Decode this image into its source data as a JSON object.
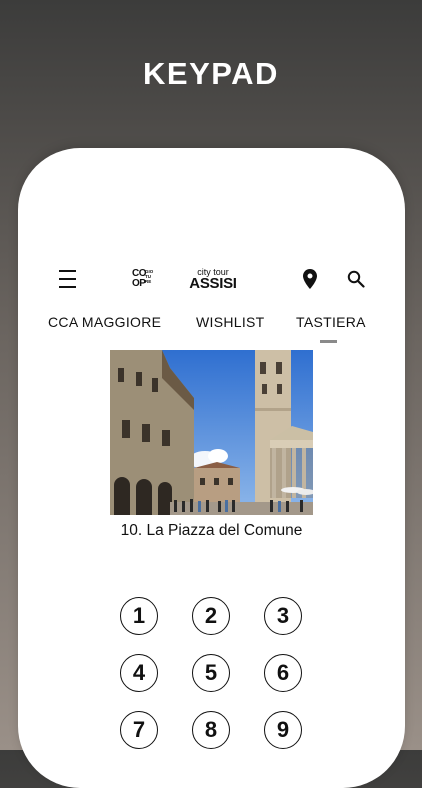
{
  "promo": {
    "title": "KEYPAD"
  },
  "header": {
    "logo_text_1": "CO",
    "logo_text_2": "OP",
    "logo_small_1": "GIO",
    "logo_small_2": "TU",
    "logo_small_3": "RE",
    "subtitle": "city tour",
    "title": "ASSISI"
  },
  "tabs": [
    {
      "label": "CCA MAGGIORE"
    },
    {
      "label": "WISHLIST"
    },
    {
      "label": "TASTIERA",
      "selected": true
    }
  ],
  "content": {
    "caption": "10. La Piazza del Comune"
  },
  "keypad": {
    "keys": [
      "1",
      "2",
      "3",
      "4",
      "5",
      "6",
      "7",
      "8",
      "9"
    ]
  },
  "colors": {
    "background_top": "#3c3c3b",
    "background_bottom": "#9a9088",
    "accent_text": "#111111",
    "tab_indicator": "#8a8a8a"
  },
  "icons": {
    "menu": "menu-icon",
    "location": "map-pin-icon",
    "search": "search-icon"
  }
}
